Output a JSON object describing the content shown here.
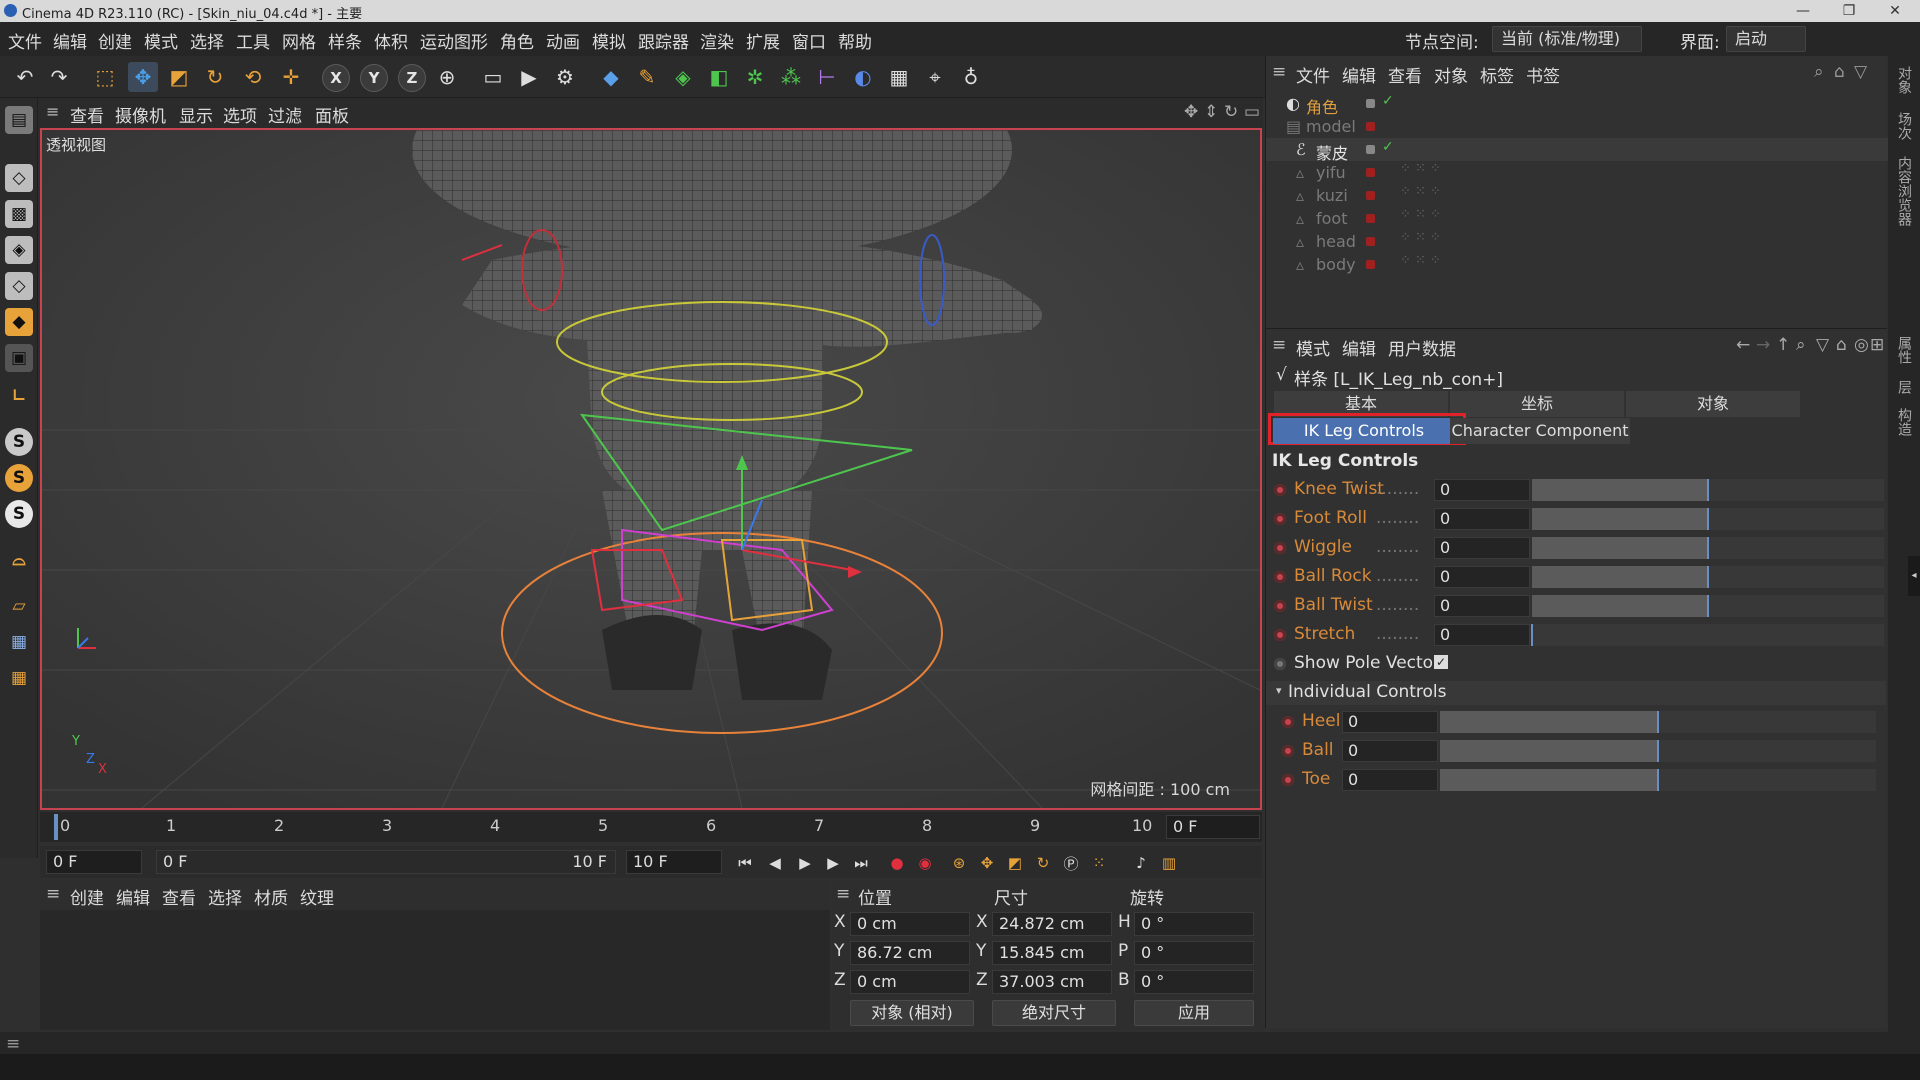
{
  "window": {
    "title": "Cinema 4D R23.110 (RC) - [Skin_niu_04.c4d *] - 主要",
    "minimize": "—",
    "maximize": "❐",
    "close": "✕"
  },
  "menubar": {
    "items": [
      "文件",
      "编辑",
      "创建",
      "模式",
      "选择",
      "工具",
      "网格",
      "样条",
      "体积",
      "运动图形",
      "角色",
      "动画",
      "模拟",
      "跟踪器",
      "渲染",
      "扩展",
      "窗口",
      "帮助"
    ],
    "node_space_label": "节点空间:",
    "node_space_value": "当前 (标准/物理)",
    "layout_label": "界面:",
    "layout_value": "启动"
  },
  "toolbar": {
    "axis_x": "X",
    "axis_y": "Y",
    "axis_z": "Z"
  },
  "viewport": {
    "menu": [
      "查看",
      "摄像机",
      "显示",
      "选项",
      "过滤",
      "面板"
    ],
    "view_name": "透视视图",
    "grid_spacing": "网格间距 : 100 cm",
    "axis_y": "Y",
    "axis_z": "Z",
    "axis_x": "X"
  },
  "timeline": {
    "ticks": [
      "0",
      "1",
      "2",
      "3",
      "4",
      "5",
      "6",
      "7",
      "8",
      "9",
      "10"
    ],
    "current_frame_display": "0 F"
  },
  "transport": {
    "start_frame": "0 F",
    "range_start": "0 F",
    "range_end": "10 F",
    "end_frame": "10 F"
  },
  "material_manager": {
    "menu": [
      "创建",
      "编辑",
      "查看",
      "选择",
      "材质",
      "纹理"
    ]
  },
  "coord_manager": {
    "headers": {
      "position": "位置",
      "size": "尺寸",
      "rotation": "旋转"
    },
    "rows": [
      {
        "axis": "X",
        "pos": "0 cm",
        "size_axis": "X",
        "size": "24.872 cm",
        "rot_axis": "H",
        "rot": "0 °"
      },
      {
        "axis": "Y",
        "pos": "86.72 cm",
        "size_axis": "Y",
        "size": "15.845 cm",
        "rot_axis": "P",
        "rot": "0 °"
      },
      {
        "axis": "Z",
        "pos": "0 cm",
        "size_axis": "Z",
        "size": "37.003 cm",
        "rot_axis": "B",
        "rot": "0 °"
      }
    ],
    "mode_dropdown": "对象 (相对)",
    "size_dropdown": "绝对尺寸",
    "apply_button": "应用"
  },
  "object_manager": {
    "menu": [
      "文件",
      "编辑",
      "查看",
      "对象",
      "标签",
      "书签"
    ],
    "objects": [
      {
        "name": "角色",
        "color": "#e0a040",
        "indent": 0
      },
      {
        "name": "model",
        "color": "#7a7a7a",
        "indent": 0
      },
      {
        "name": "蒙皮",
        "color": "#e6e6e6",
        "indent": 1
      },
      {
        "name": "yifu",
        "color": "#7a7a7a",
        "indent": 1
      },
      {
        "name": "kuzi",
        "color": "#7a7a7a",
        "indent": 1
      },
      {
        "name": "foot",
        "color": "#7a7a7a",
        "indent": 1
      },
      {
        "name": "head",
        "color": "#7a7a7a",
        "indent": 1
      },
      {
        "name": "body",
        "color": "#7a7a7a",
        "indent": 1
      }
    ]
  },
  "attribute_manager": {
    "menu": [
      "模式",
      "编辑",
      "用户数据"
    ],
    "object_title": "样条 [L_IK_Leg_nb_con+]",
    "tabs_row1": [
      "基本",
      "坐标",
      "对象"
    ],
    "tabs_row2": [
      "IK Leg Controls",
      "Character Component"
    ],
    "section_title": "IK Leg Controls",
    "params": [
      {
        "label": "Knee Twist",
        "value": "0",
        "fill": 0.5
      },
      {
        "label": "Foot Roll",
        "value": "0",
        "fill": 0.5
      },
      {
        "label": "Wiggle",
        "value": "0",
        "fill": 0.5
      },
      {
        "label": "Ball Rock",
        "value": "0",
        "fill": 0.5
      },
      {
        "label": "Ball Twist",
        "value": "0",
        "fill": 0.5
      },
      {
        "label": "Stretch",
        "value": "0",
        "fill": 0.0
      }
    ],
    "show_pole_vector_label": "Show Pole Vector",
    "show_pole_vector_checked": true,
    "individual_controls_title": "Individual Controls",
    "individual_params": [
      {
        "label": "Heel",
        "value": "0",
        "fill": 0.5
      },
      {
        "label": "Ball",
        "value": "0",
        "fill": 0.5
      },
      {
        "label": "Toe",
        "value": "0",
        "fill": 0.5
      }
    ]
  },
  "right_strip": [
    "对象",
    "场次",
    "内容浏览器",
    "属性",
    "层",
    "构造"
  ],
  "colors": {
    "highlight_red": "#e0222a",
    "tab_active": "#4a70b0",
    "param_label": "#d88a3a"
  }
}
